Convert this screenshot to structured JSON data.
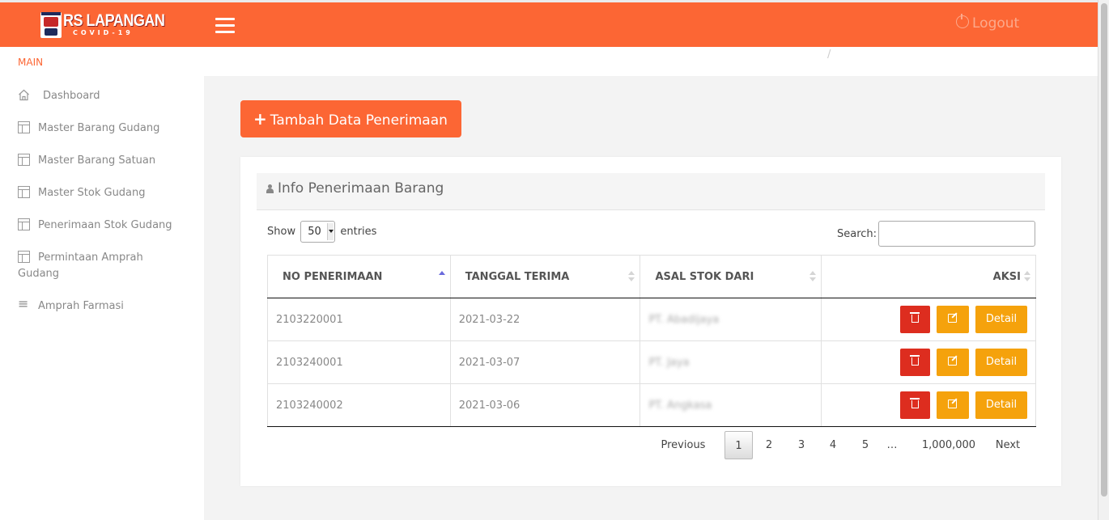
{
  "brand": {
    "title": "RS LAPANGAN",
    "subtitle": "COVID-19"
  },
  "topbar": {
    "logout_label": "Logout"
  },
  "sidebar": {
    "heading": "MAIN",
    "items": [
      {
        "label": "Dashboard",
        "icon": "home-icon"
      },
      {
        "label": "Master Barang Gudang",
        "icon": "table-icon"
      },
      {
        "label": "Master Barang Satuan",
        "icon": "table-icon"
      },
      {
        "label": "Master Stok Gudang",
        "icon": "table-icon"
      },
      {
        "label": "Penerimaan Stok Gudang",
        "icon": "table-icon"
      },
      {
        "label": "Permintaan Amprah Gudang",
        "icon": "table-icon"
      },
      {
        "label": "Amprah Farmasi",
        "icon": "list-icon"
      }
    ]
  },
  "breadcrumb_sep": "/",
  "add_button": {
    "label": "Tambah Data Penerimaan"
  },
  "card": {
    "title": "Info Penerimaan Barang"
  },
  "table_controls": {
    "show_label": "Show",
    "entries_value": "50",
    "entries_label": "entries",
    "search_label": "Search:",
    "search_value": ""
  },
  "table": {
    "headers": [
      "NO PENERIMAAN",
      "TANGGAL TERIMA",
      "ASAL STOK DARI",
      "AKSI"
    ],
    "rows": [
      {
        "no": "2103220001",
        "tanggal": "2021-03-22",
        "asal": "PT. Abadijaya"
      },
      {
        "no": "2103240001",
        "tanggal": "2021-03-07",
        "asal": "PT. Jaya"
      },
      {
        "no": "2103240002",
        "tanggal": "2021-03-06",
        "asal": "PT. Angkasa"
      }
    ],
    "detail_label": "Detail"
  },
  "pagination": {
    "previous": "Previous",
    "pages": [
      "1",
      "2",
      "3",
      "4",
      "5",
      "…",
      "1,000,000"
    ],
    "current": "1",
    "next": "Next"
  },
  "colors": {
    "accent": "#fc6634",
    "danger": "#dd2d1f",
    "warning": "#f5a20c"
  }
}
